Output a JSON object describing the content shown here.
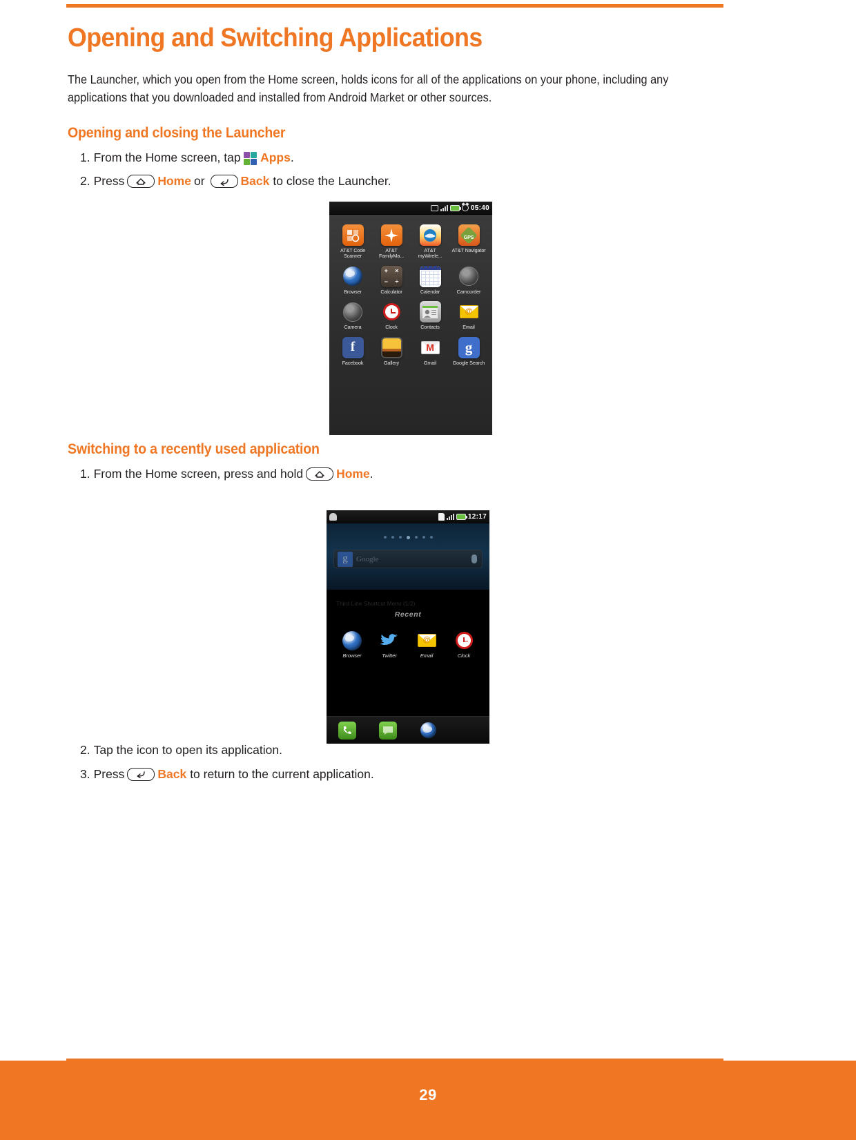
{
  "document": {
    "title": "Opening and Switching Applications",
    "page_number": "29",
    "accent_color": "#ef7622",
    "intro": "The Launcher, which you open from the Home screen, holds icons for all of the applications on your phone, including any applications that you downloaded and installed from Android Market or other sources."
  },
  "section1": {
    "heading": "Opening and closing the Launcher",
    "step1": {
      "number": "1.",
      "text_before": "From the Home screen, tap",
      "keyword": "Apps",
      "text_after": "."
    },
    "step2": {
      "number": "2.",
      "text_before": "Press",
      "keyword1": "Home",
      "conjunction": "or",
      "keyword2": "Back",
      "text_after": "to close the Launcher."
    }
  },
  "section2": {
    "heading": "Switching to a recently used application",
    "step1": {
      "number": "1.",
      "text_before": "From the Home screen, press and hold",
      "keyword": "Home",
      "text_after": "."
    },
    "step2": {
      "number": "2.",
      "text": "Tap the icon to open its application."
    },
    "step3": {
      "number": "3.",
      "text_before": "Press",
      "keyword": "Back",
      "text_after": "to return to the current application."
    }
  },
  "launcher_screenshot": {
    "status_bar": {
      "time": "05:40",
      "icons": [
        "vibrate-icon",
        "signal-icon",
        "battery-icon",
        "alarm-icon"
      ]
    },
    "apps": [
      {
        "label": "AT&T Code Scanner",
        "icon": "att-code-scanner-icon"
      },
      {
        "label": "AT&T FamilyMa...",
        "icon": "att-familymap-icon"
      },
      {
        "label": "AT&T myWirele...",
        "icon": "att-mywireless-icon"
      },
      {
        "label": "AT&T Navigator",
        "icon": "att-navigator-icon"
      },
      {
        "label": "Browser",
        "icon": "browser-icon"
      },
      {
        "label": "Calculator",
        "icon": "calculator-icon"
      },
      {
        "label": "Calendar",
        "icon": "calendar-icon"
      },
      {
        "label": "Camcorder",
        "icon": "camcorder-icon"
      },
      {
        "label": "Camera",
        "icon": "camera-icon"
      },
      {
        "label": "Clock",
        "icon": "clock-icon"
      },
      {
        "label": "Contacts",
        "icon": "contacts-icon"
      },
      {
        "label": "Email",
        "icon": "email-icon"
      },
      {
        "label": "Facebook",
        "icon": "facebook-icon"
      },
      {
        "label": "Gallery",
        "icon": "gallery-icon"
      },
      {
        "label": "Gmail",
        "icon": "gmail-icon"
      },
      {
        "label": "Google Search",
        "icon": "google-search-icon"
      }
    ],
    "calculator_keys": [
      "+",
      "×",
      "−",
      "÷"
    ],
    "facebook_glyph": "f",
    "google_glyph": "g"
  },
  "recent_screenshot": {
    "status_bar": {
      "time": "12:17",
      "icons": [
        "android-icon",
        "sim-icon",
        "signal-icon",
        "battery-icon"
      ]
    },
    "search_placeholder": "Google",
    "ghost_text": "Third Line Shortcut Menu (1/2)",
    "recent_title": "Recent",
    "recent_apps": [
      {
        "label": "Browser",
        "icon": "browser-icon"
      },
      {
        "label": "Twitter",
        "icon": "twitter-icon"
      },
      {
        "label": "Email",
        "icon": "email-icon"
      },
      {
        "label": "Clock",
        "icon": "clock-icon"
      }
    ],
    "dock": [
      {
        "icon": "phone-icon"
      },
      {
        "icon": "messaging-icon"
      },
      {
        "icon": "browser-icon"
      },
      {
        "icon": "apps-grid-icon"
      }
    ]
  }
}
